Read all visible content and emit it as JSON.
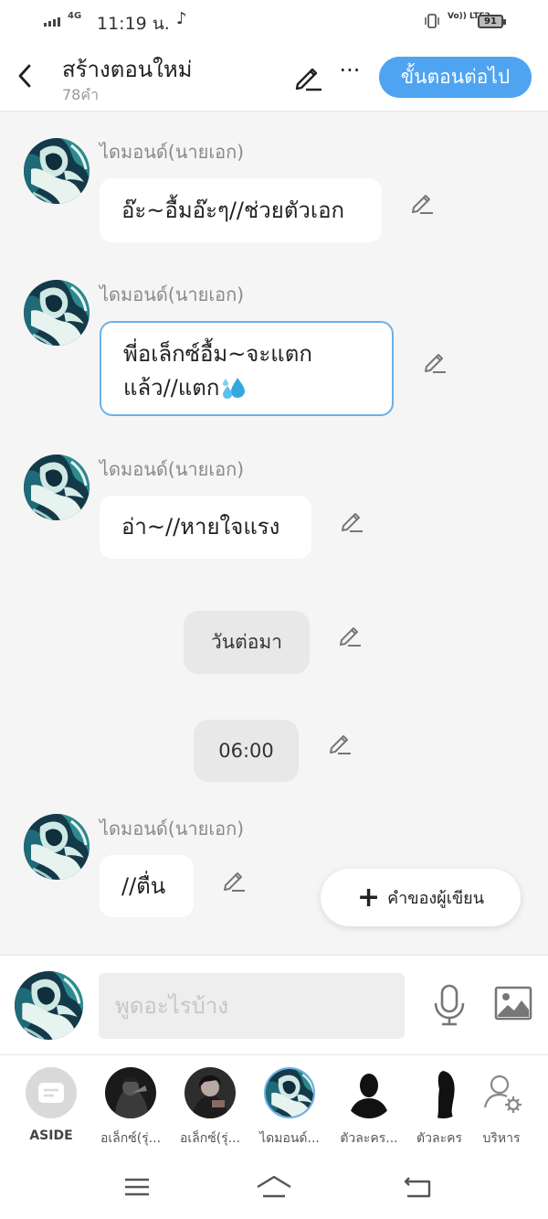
{
  "status_bar": {
    "network": "4G",
    "time": "11:19 น.",
    "volte": "Vo)) LTE2",
    "battery": "91"
  },
  "header": {
    "title": "สร้างตอนใหม่",
    "word_count": "78คำ",
    "more": "···",
    "next_button": "ขั้นตอนต่อไป"
  },
  "messages": [
    {
      "sender": "ไดมอนด์(นายเอก)",
      "text": "อ๊ะ~อื้มอ๊ะๆ//ช่วยตัวเอก"
    },
    {
      "sender": "ไดมอนด์(นายเอก)",
      "line1": "พี่อเล็กซ์อื้ม~จะแตก",
      "line2": "แล้ว//แตก",
      "emoji": "sweat-droplets"
    },
    {
      "sender": "ไดมอนด์(นายเอก)",
      "text": "อ่า~//หายใจแรง"
    },
    {
      "pill": "วันต่อมา"
    },
    {
      "pill": "06:00"
    },
    {
      "sender": "ไดมอนด์(นายเอก)",
      "text": "//ตื่น"
    }
  ],
  "author_button": {
    "plus": "+",
    "label": "คำของผู้เขียน"
  },
  "input": {
    "placeholder": "พูดอะไรบ้าง"
  },
  "characters": [
    {
      "label": "ASIDE",
      "icon": "aside-icon"
    },
    {
      "label": "อเล็กซ์(รุ่..."
    },
    {
      "label": "อเล็กซ์(รุ่..."
    },
    {
      "label": "ไดมอนด์..."
    },
    {
      "label": "ตัวละคร..."
    },
    {
      "label": "ตัวละคร"
    },
    {
      "label": "บริหาร",
      "icon": "manage-characters-icon"
    }
  ],
  "colors": {
    "accent": "#4ea4f0",
    "chat_bg": "#f5f5f5",
    "bubble": "#ffffff",
    "pill": "#e8e8e8",
    "sender": "#8a8a8a"
  }
}
